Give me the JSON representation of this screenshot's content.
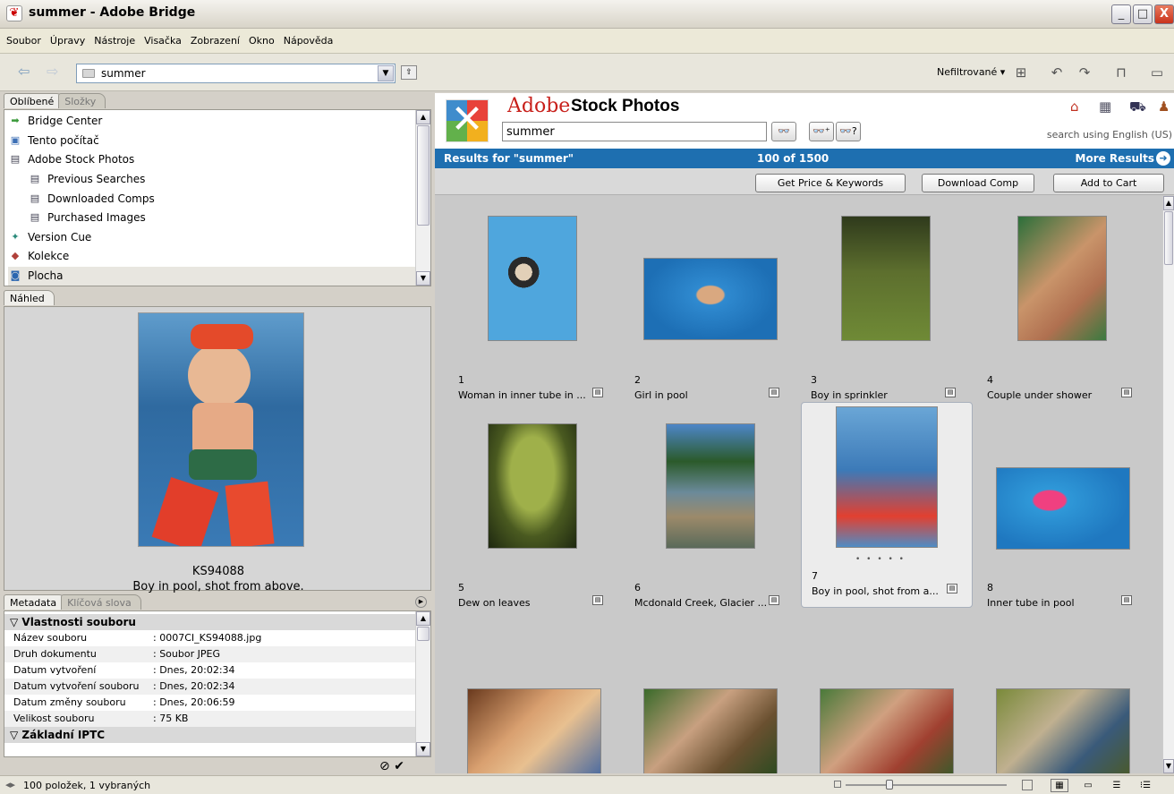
{
  "window": {
    "title": "summer - Adobe Bridge",
    "minimize": "_",
    "maximize": "□",
    "close": "X"
  },
  "menu": [
    "Soubor",
    "Úpravy",
    "Nástroje",
    "Visačka",
    "Zobrazení",
    "Okno",
    "Nápověda"
  ],
  "toolbar": {
    "back": "⇦",
    "forward": "⇨",
    "path": "summer",
    "filter": "Nefiltrované ▾"
  },
  "favorites": {
    "tabs": [
      "Oblíbené",
      "Složky"
    ],
    "items": [
      {
        "label": "Bridge Center",
        "icon": "arrow-icon"
      },
      {
        "label": "Tento počítač",
        "icon": "computer-icon"
      },
      {
        "label": "Adobe Stock Photos",
        "icon": "stock-icon"
      },
      {
        "label": "Previous Searches",
        "icon": "stock-icon"
      },
      {
        "label": "Downloaded Comps",
        "icon": "stock-icon"
      },
      {
        "label": "Purchased Images",
        "icon": "stock-icon"
      },
      {
        "label": "Version Cue",
        "icon": "version-cue-icon"
      },
      {
        "label": "Kolekce",
        "icon": "collection-icon"
      },
      {
        "label": "Plocha",
        "icon": "desktop-icon"
      }
    ]
  },
  "preview": {
    "tab": "Náhled",
    "id": "KS94088",
    "caption": "Boy in pool, shot from above."
  },
  "metadata": {
    "tabs": [
      "Metadata",
      "Klíčová slova"
    ],
    "section1": "▽ Vlastnosti souboru",
    "rows": [
      {
        "k": "Název souboru",
        "v": ": 0007CI_KS94088.jpg"
      },
      {
        "k": "Druh dokumentu",
        "v": ": Soubor JPEG"
      },
      {
        "k": "Datum vytvoření",
        "v": ": Dnes, 20:02:34"
      },
      {
        "k": "Datum vytvoření souboru",
        "v": ": Dnes, 20:02:34"
      },
      {
        "k": "Datum změny souboru",
        "v": ": Dnes, 20:06:59"
      },
      {
        "k": "Velikost souboru",
        "v": ": 75 KB"
      }
    ],
    "section2": "▽ Základní IPTC"
  },
  "stock": {
    "brand1": "Adobe",
    "brand2": "Stock Photos",
    "search_value": "summer",
    "lang_note": "search using English (US)",
    "results_for": "Results for \"summer\"",
    "count": "100 of 1500",
    "more": "More Results",
    "buttons": [
      "Get Price & Keywords",
      "Download Comp",
      "Add to Cart"
    ]
  },
  "thumbnails": [
    {
      "num": "1",
      "title": "Woman in inner tube in ..."
    },
    {
      "num": "2",
      "title": "Girl in pool"
    },
    {
      "num": "3",
      "title": "Boy in sprinkler"
    },
    {
      "num": "4",
      "title": "Couple under shower"
    },
    {
      "num": "5",
      "title": "Dew on leaves"
    },
    {
      "num": "6",
      "title": "Mcdonald Creek, Glacier ..."
    },
    {
      "num": "7",
      "title": "Boy in pool, shot from a..."
    },
    {
      "num": "8",
      "title": "Inner tube in pool"
    }
  ],
  "selected_dots": "• • • • •",
  "status": "100 položek, 1 vybraných"
}
